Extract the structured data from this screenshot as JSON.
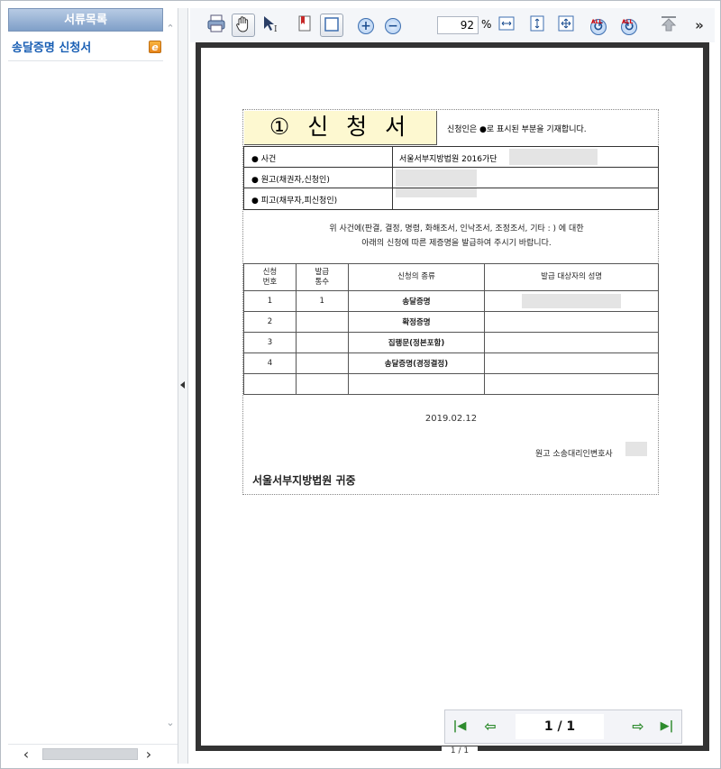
{
  "sidebar": {
    "header": "서류목록",
    "documents": [
      {
        "label": "송달증명 신청서",
        "icon": "ie-document-icon",
        "icon_glyph": "e"
      }
    ]
  },
  "toolbar": {
    "zoom_value": "92",
    "zoom_unit": "%",
    "more": "»",
    "all_badge": "ALL",
    "icons": [
      "printer-icon",
      "hand-tool-icon",
      "select-text-icon",
      "bookmark-icon",
      "fit-page-icon",
      "zoom-in-icon",
      "zoom-out-icon",
      "fit-width-icon",
      "fit-height-icon",
      "fullscreen-icon",
      "rotate-all-left-icon",
      "rotate-all-right-icon",
      "upload-icon"
    ]
  },
  "form": {
    "title": "① 신 청 서",
    "note": "신청인은 ●로 표시된 부분을 기재합니다.",
    "rows": [
      {
        "label": "● 사건",
        "value": "서울서부지방법원 2016가단"
      },
      {
        "label": "● 원고(채권자,신청인)",
        "value": ""
      },
      {
        "label": "● 피고(채무자,피신청인)",
        "value": ""
      }
    ],
    "statement_line1": "위 사건에(판결, 결정, 명령, 화해조서, 인낙조서, 조정조서, 기타 :                    ) 에 대한",
    "statement_line2": "아래의 신청에 따른 제증명을 발급하여 주시기 바랍니다.",
    "table": {
      "headers": [
        "신청\n번호",
        "발급\n통수",
        "신청의 종류",
        "발급 대상자의 성명"
      ],
      "rows": [
        [
          "1",
          "1",
          "송달증명",
          ""
        ],
        [
          "2",
          "",
          "확정증명",
          ""
        ],
        [
          "3",
          "",
          "집행문(정본포함)",
          ""
        ],
        [
          "4",
          "",
          "송달증명(경정결정)",
          ""
        ],
        [
          "",
          "",
          "",
          ""
        ]
      ]
    },
    "date": "2019.02.12",
    "agent": "원고 소송대리인변호사",
    "court": "서울서부지방법원  귀중"
  },
  "navigation": {
    "page_input": "1 / 1",
    "page_indicator": "1 / 1"
  }
}
